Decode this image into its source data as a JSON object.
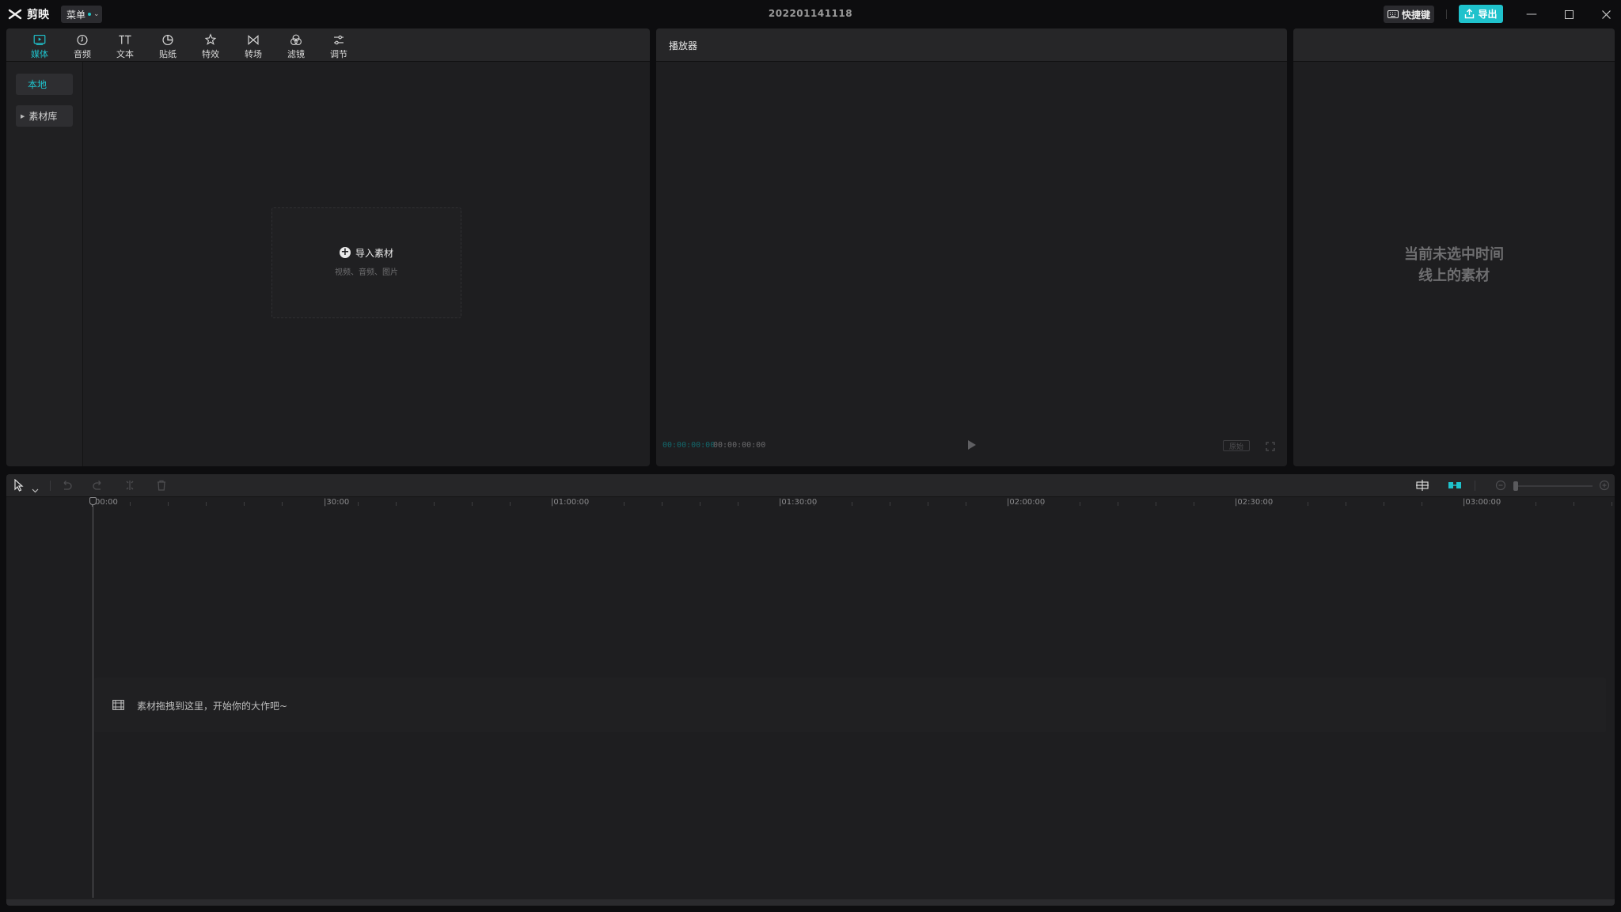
{
  "app": {
    "name": "剪映",
    "menu_label": "菜单",
    "doc_title": "202201141118",
    "shortcut_label": "快捷键",
    "export_label": "导出"
  },
  "media": {
    "tabs": [
      {
        "label": "媒体",
        "icon": "media-icon",
        "active": true
      },
      {
        "label": "音频",
        "icon": "audio-icon"
      },
      {
        "label": "文本",
        "icon": "text-icon"
      },
      {
        "label": "贴纸",
        "icon": "sticker-icon"
      },
      {
        "label": "特效",
        "icon": "effects-icon"
      },
      {
        "label": "转场",
        "icon": "transition-icon"
      },
      {
        "label": "滤镜",
        "icon": "filter-icon"
      },
      {
        "label": "调节",
        "icon": "adjust-icon"
      }
    ],
    "nav": {
      "local": "本地",
      "library": "素材库"
    },
    "import": {
      "label": "导入素材",
      "hint": "视频、音频、图片"
    }
  },
  "player": {
    "title": "播放器",
    "current_time": "00:00:00:00",
    "total_time": "00:00:00:00",
    "ratio_label": "原始"
  },
  "inspector": {
    "empty_line1": "当前未选中时间",
    "empty_line2": "线上的素材"
  },
  "timeline": {
    "ruler": [
      "00:00",
      "|30:00",
      "|01:00:00",
      "|01:30:00",
      "|02:00:00",
      "|02:30:00",
      "|03:00:00"
    ],
    "drop_hint": "素材拖拽到这里，开始你的大作吧~"
  },
  "colors": {
    "accent": "#1fc2cc",
    "panel": "#1e1e20",
    "background": "#0d0d0f"
  }
}
